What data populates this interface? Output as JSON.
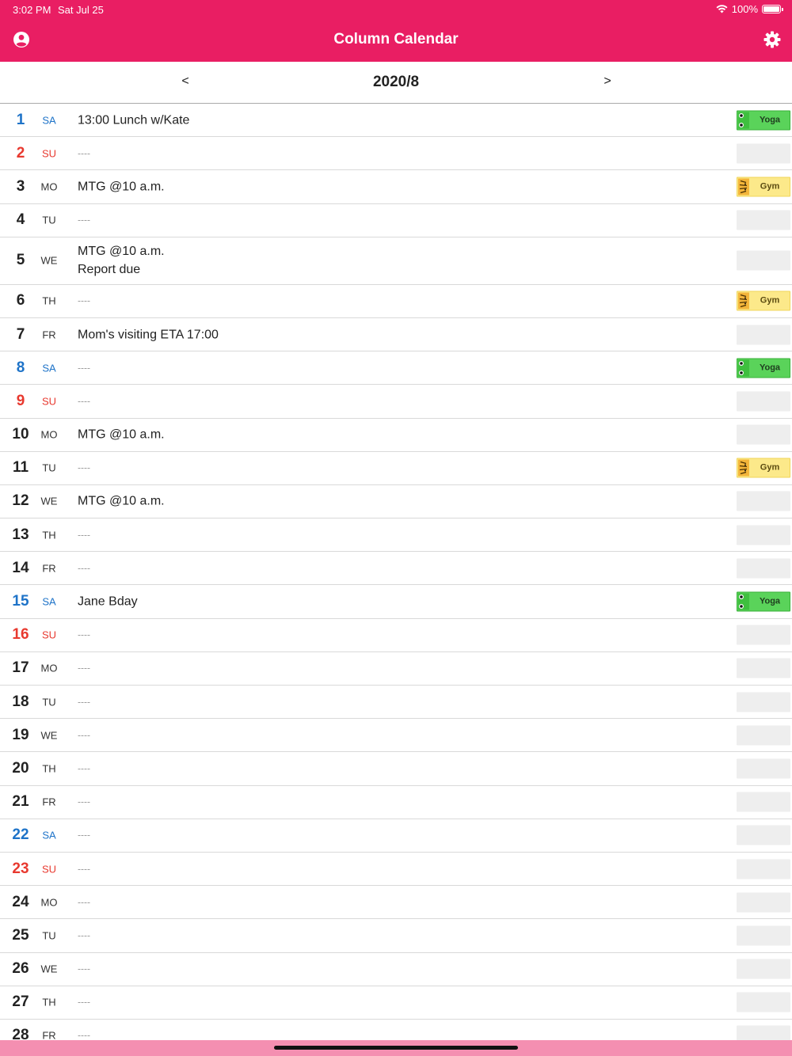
{
  "status": {
    "time": "3:02 PM",
    "date": "Sat Jul 25",
    "battery": "100%"
  },
  "header": {
    "title": "Column Calendar"
  },
  "month": {
    "label": "2020/8",
    "prev": "<",
    "next": ">"
  },
  "colors": {
    "accent": "#e91e63",
    "saturday": "#1e73c8",
    "sunday": "#e8392f",
    "yoga_tag": "#5ad35a",
    "gym_tag": "#fce98a"
  },
  "days": [
    {
      "num": "1",
      "dow": "SA",
      "events": "13:00 Lunch w/Kate",
      "tag": "Yoga",
      "tag_icon": "frog-icon"
    },
    {
      "num": "2",
      "dow": "SU",
      "events": "----",
      "tag": ""
    },
    {
      "num": "3",
      "dow": "MO",
      "events": "MTG @10 a.m.",
      "tag": "Gym",
      "tag_icon": "tiger-icon"
    },
    {
      "num": "4",
      "dow": "TU",
      "events": "----",
      "tag": ""
    },
    {
      "num": "5",
      "dow": "WE",
      "events": "MTG @10 a.m.\nReport due",
      "tag": ""
    },
    {
      "num": "6",
      "dow": "TH",
      "events": "----",
      "tag": "Gym",
      "tag_icon": "tiger-icon"
    },
    {
      "num": "7",
      "dow": "FR",
      "events": "Mom's visiting ETA 17:00",
      "tag": ""
    },
    {
      "num": "8",
      "dow": "SA",
      "events": "----",
      "tag": "Yoga",
      "tag_icon": "frog-icon"
    },
    {
      "num": "9",
      "dow": "SU",
      "events": "----",
      "tag": ""
    },
    {
      "num": "10",
      "dow": "MO",
      "events": "MTG @10 a.m.",
      "tag": ""
    },
    {
      "num": "11",
      "dow": "TU",
      "events": "----",
      "tag": "Gym",
      "tag_icon": "tiger-icon"
    },
    {
      "num": "12",
      "dow": "WE",
      "events": "MTG @10 a.m.",
      "tag": ""
    },
    {
      "num": "13",
      "dow": "TH",
      "events": "----",
      "tag": ""
    },
    {
      "num": "14",
      "dow": "FR",
      "events": "----",
      "tag": ""
    },
    {
      "num": "15",
      "dow": "SA",
      "events": "Jane Bday",
      "tag": "Yoga",
      "tag_icon": "frog-icon"
    },
    {
      "num": "16",
      "dow": "SU",
      "events": "----",
      "tag": ""
    },
    {
      "num": "17",
      "dow": "MO",
      "events": "----",
      "tag": ""
    },
    {
      "num": "18",
      "dow": "TU",
      "events": "----",
      "tag": ""
    },
    {
      "num": "19",
      "dow": "WE",
      "events": "----",
      "tag": ""
    },
    {
      "num": "20",
      "dow": "TH",
      "events": "----",
      "tag": ""
    },
    {
      "num": "21",
      "dow": "FR",
      "events": "----",
      "tag": ""
    },
    {
      "num": "22",
      "dow": "SA",
      "events": "----",
      "tag": ""
    },
    {
      "num": "23",
      "dow": "SU",
      "events": "----",
      "tag": ""
    },
    {
      "num": "24",
      "dow": "MO",
      "events": "----",
      "tag": ""
    },
    {
      "num": "25",
      "dow": "TU",
      "events": "----",
      "tag": ""
    },
    {
      "num": "26",
      "dow": "WE",
      "events": "----",
      "tag": ""
    },
    {
      "num": "27",
      "dow": "TH",
      "events": "----",
      "tag": ""
    },
    {
      "num": "28",
      "dow": "FR",
      "events": "----",
      "tag": ""
    }
  ]
}
